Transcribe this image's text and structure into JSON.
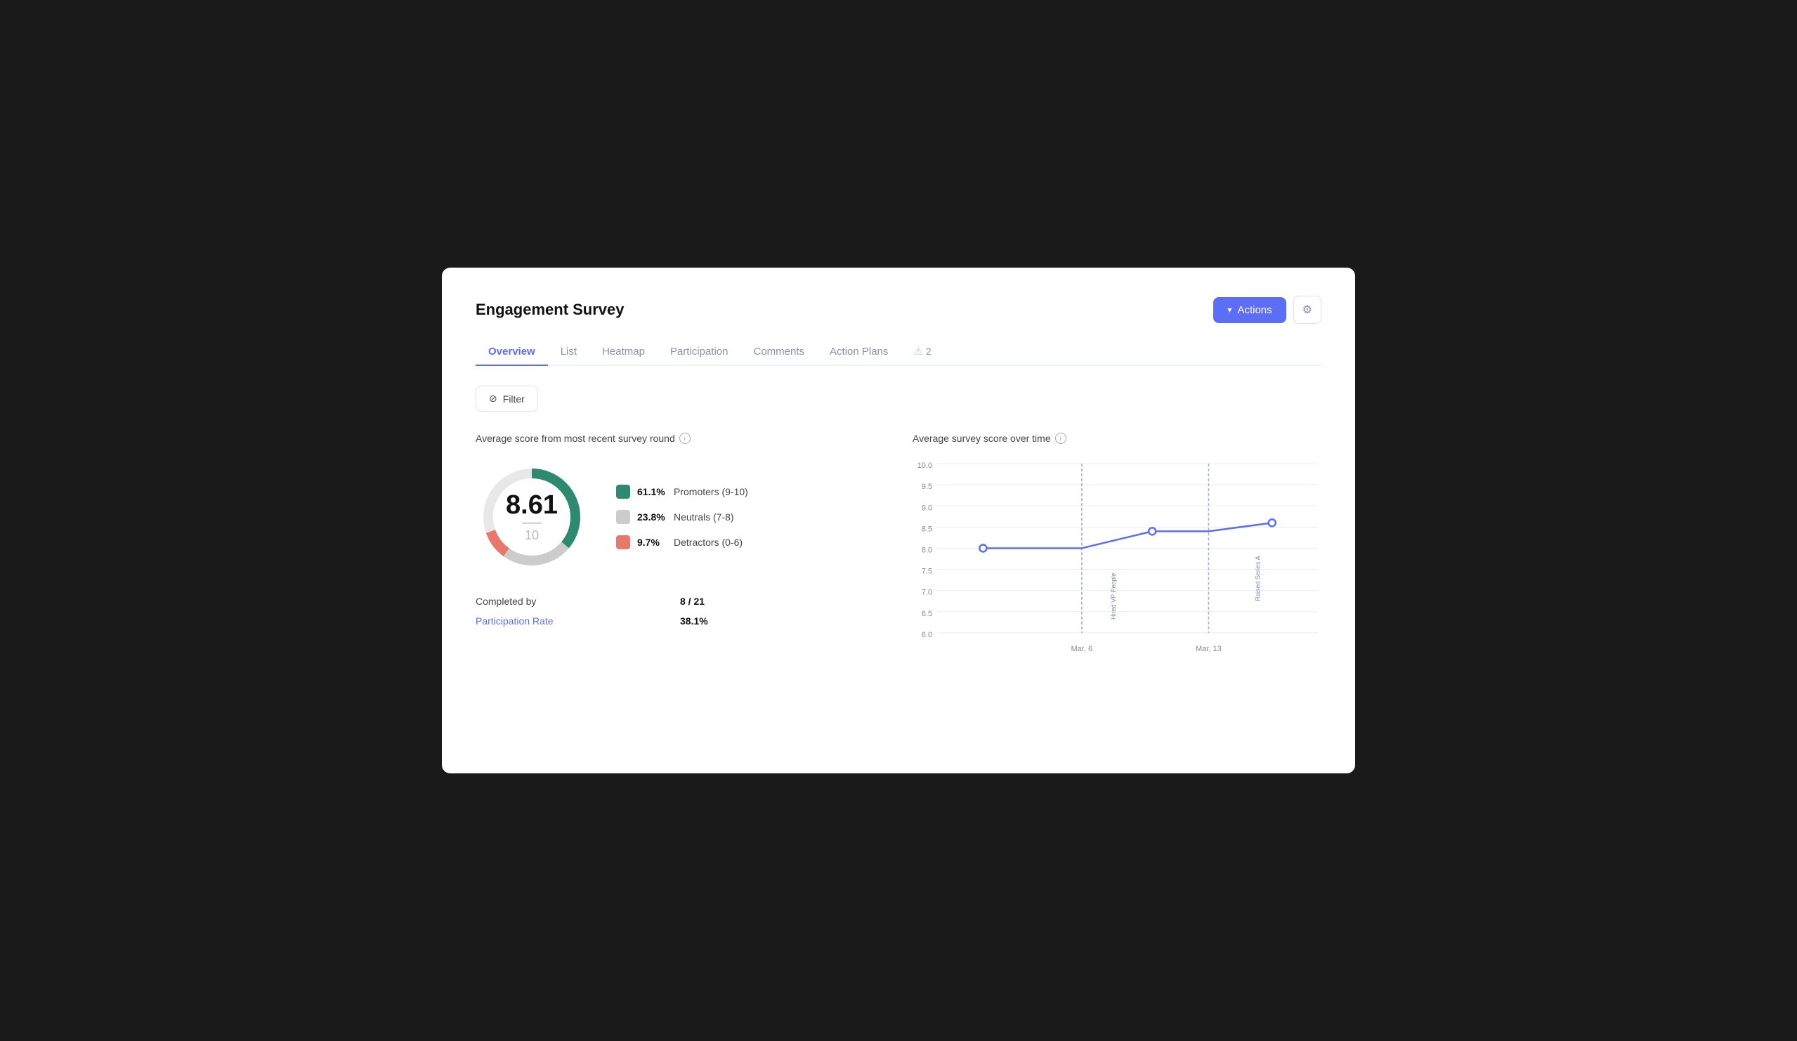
{
  "header": {
    "title": "Engagement Survey",
    "actions_label": "Actions",
    "settings_aria": "Settings"
  },
  "tabs": [
    {
      "id": "overview",
      "label": "Overview",
      "active": true
    },
    {
      "id": "list",
      "label": "List",
      "active": false
    },
    {
      "id": "heatmap",
      "label": "Heatmap",
      "active": false
    },
    {
      "id": "participation",
      "label": "Participation",
      "active": false
    },
    {
      "id": "comments",
      "label": "Comments",
      "active": false
    },
    {
      "id": "action-plans",
      "label": "Action Plans",
      "active": false
    }
  ],
  "tab_badge": {
    "count": "2"
  },
  "filter": {
    "label": "Filter"
  },
  "left_panel": {
    "section_label": "Average score from most recent survey round",
    "score": "8.61",
    "max": "10",
    "legend": [
      {
        "label": "Promoters (9-10)",
        "pct": "61.1%",
        "color": "#2d8a6e"
      },
      {
        "label": "Neutrals (7-8)",
        "pct": "23.8%",
        "color": "#cccccc"
      },
      {
        "label": "Detractors (0-6)",
        "pct": "9.7%",
        "color": "#e8786a"
      }
    ],
    "completed_label": "Completed by",
    "completed_value": "8 / 21",
    "participation_label": "Participation Rate",
    "participation_value": "38.1%"
  },
  "right_panel": {
    "section_label": "Average survey score over time",
    "y_labels": [
      "10.0",
      "9.5",
      "9.0",
      "8.5",
      "8.0",
      "7.5",
      "7.0",
      "6.5",
      "6.0"
    ],
    "x_labels": [
      "Mar, 6",
      "Mar, 13"
    ],
    "annotations": [
      {
        "label": "Hired VP People",
        "x_pct": 38
      },
      {
        "label": "Raised Series A",
        "x_pct": 72
      }
    ],
    "data_points": [
      {
        "x_pct": 18,
        "y_pct": 66
      },
      {
        "x_pct": 38,
        "y_pct": 66
      },
      {
        "x_pct": 58,
        "y_pct": 54
      },
      {
        "x_pct": 72,
        "y_pct": 54
      },
      {
        "x_pct": 90,
        "y_pct": 50
      }
    ]
  },
  "colors": {
    "accent": "#5b6ef5",
    "promoter": "#2d8a6e",
    "neutral": "#cccccc",
    "detractor": "#e8786a",
    "chart_line": "#5b6ef5",
    "annotation": "#a0a8d8"
  }
}
